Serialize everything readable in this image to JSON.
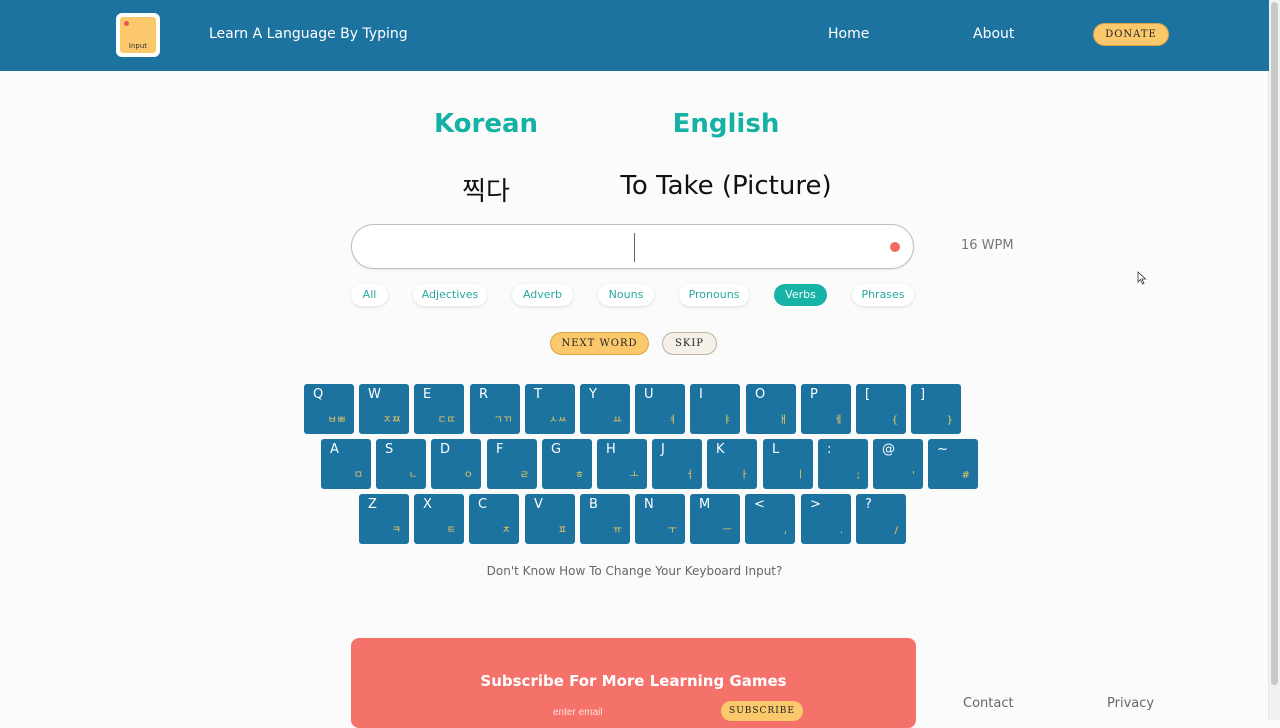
{
  "header": {
    "logo_text": "Input",
    "site_title": "Learn A Language By Typing",
    "nav": [
      "Home",
      "About"
    ],
    "donate_label": "DONATE"
  },
  "languages": {
    "source": "Korean",
    "target": "English"
  },
  "prompt": {
    "source_word": "찍다",
    "target_word": "To Take (Picture)"
  },
  "typing": {
    "value": "",
    "placeholder": "",
    "wpm": "16 WPM"
  },
  "categories": [
    {
      "label": "All",
      "active": false
    },
    {
      "label": "Adjectives",
      "active": false
    },
    {
      "label": "Adverb",
      "active": false
    },
    {
      "label": "Nouns",
      "active": false
    },
    {
      "label": "Pronouns",
      "active": false
    },
    {
      "label": "Verbs",
      "active": true
    },
    {
      "label": "Phrases",
      "active": false
    }
  ],
  "actions": {
    "next_label": "NEXT WORD",
    "skip_label": "SKIP"
  },
  "keyboard": {
    "rows": [
      [
        {
          "key": "Q",
          "sub": "ㅂㅃ"
        },
        {
          "key": "W",
          "sub": "ㅈㅉ"
        },
        {
          "key": "E",
          "sub": "ㄷㄸ"
        },
        {
          "key": "R",
          "sub": "ㄱㄲ"
        },
        {
          "key": "T",
          "sub": "ㅅㅆ"
        },
        {
          "key": "Y",
          "sub": "ㅛ"
        },
        {
          "key": "U",
          "sub": "ㅕ"
        },
        {
          "key": "I",
          "sub": "ㅑ"
        },
        {
          "key": "O",
          "sub": "ㅐ"
        },
        {
          "key": "P",
          "sub": "ㅔ"
        },
        {
          "key": "[",
          "sub": "{"
        },
        {
          "key": "]",
          "sub": "}"
        }
      ],
      [
        {
          "key": "A",
          "sub": "ㅁ"
        },
        {
          "key": "S",
          "sub": "ㄴ"
        },
        {
          "key": "D",
          "sub": "ㅇ"
        },
        {
          "key": "F",
          "sub": "ㄹ"
        },
        {
          "key": "G",
          "sub": "ㅎ"
        },
        {
          "key": "H",
          "sub": "ㅗ"
        },
        {
          "key": "J",
          "sub": "ㅓ"
        },
        {
          "key": "K",
          "sub": "ㅏ"
        },
        {
          "key": "L",
          "sub": "ㅣ"
        },
        {
          "key": ":",
          "sub": ";"
        },
        {
          "key": "@",
          "sub": "'"
        },
        {
          "key": "~",
          "sub": "#"
        }
      ],
      [
        {
          "key": "Z",
          "sub": "ㅋ"
        },
        {
          "key": "X",
          "sub": "ㅌ"
        },
        {
          "key": "C",
          "sub": "ㅊ"
        },
        {
          "key": "V",
          "sub": "ㅍ"
        },
        {
          "key": "B",
          "sub": "ㅠ"
        },
        {
          "key": "N",
          "sub": "ㅜ"
        },
        {
          "key": "M",
          "sub": "ㅡ"
        },
        {
          "key": "<",
          "sub": ","
        },
        {
          "key": ">",
          "sub": "."
        },
        {
          "key": "?",
          "sub": "/"
        }
      ]
    ]
  },
  "help_text": "Don't Know How To Change Your Keyboard Input?",
  "subscribe": {
    "title": "Subscribe For More Learning Games",
    "email_placeholder": "enter email",
    "button_label": "SUBSCRIBE"
  },
  "footer": {
    "contact": "Contact",
    "privacy": "Privacy"
  },
  "colors": {
    "header_bg": "#1d73a0",
    "accent_teal": "#15b1a4",
    "accent_yellow": "#fbc96c",
    "subscribe_bg": "#f5726a",
    "key_bg": "#1d73a0",
    "key_sub": "#f4c75b"
  }
}
